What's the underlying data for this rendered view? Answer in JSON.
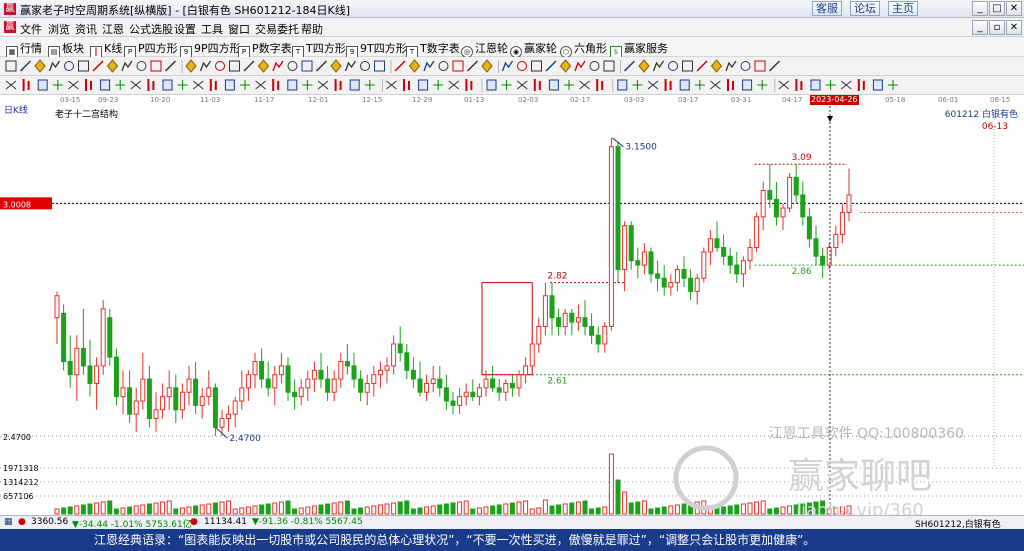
{
  "window": {
    "title": "赢家老子时空周期系统[纵横版] - [白银有色 SH601212-184日K线]",
    "top_buttons": [
      "客服",
      "论坛",
      "主页"
    ]
  },
  "menu": [
    "文件",
    "浏览",
    "资讯",
    "江恩",
    "公式选股",
    "设置",
    "工具",
    "窗口",
    "交易委托",
    "帮助"
  ],
  "toolbar1": [
    "行情",
    "板块",
    "K线",
    "P四方形",
    "9P四方形",
    "P数字表",
    "T四方形",
    "9T四方形",
    "T数字表",
    "江恩轮",
    "赢家轮",
    "六角形",
    "赢家服务"
  ],
  "dates": [
    "03-15",
    "09-23",
    "10-20",
    "11-03",
    "11-17",
    "12-01",
    "12-15",
    "12-29",
    "01-13",
    "02-03",
    "02-17",
    "03-03",
    "03-17",
    "03-31",
    "04-17",
    "2023-04-26",
    "05-18",
    "06-01",
    "06-15"
  ],
  "chart": {
    "period_label": "日K线",
    "indicator": "老子十二宫结构",
    "stock_code": "601212",
    "stock_name": "白银有色",
    "right_date": "06-13",
    "price_box_value": "3.0008",
    "low_label": "2.4700",
    "axis_low": "2.4700",
    "volume_ticks": [
      "1971318",
      "1314212",
      "657106"
    ],
    "markers": {
      "high": "3.1500",
      "box1_top": "2.82",
      "box1_bottom": "2.61",
      "box2_top": "3.09",
      "box2_bottom": "2.86"
    },
    "watermark_1": "江恩工具软件  QQ:100800360",
    "watermark_2": "赢家聊吧",
    "watermark_3": "jiaoba.vip/360"
  },
  "chart_data": {
    "type": "candlestick",
    "title": "老子十二宫结构",
    "ylabel": "",
    "ylim": [
      2.42,
      3.2
    ],
    "candles": [
      [
        2.74,
        2.8,
        2.68,
        2.79
      ],
      [
        2.75,
        2.77,
        2.62,
        2.64
      ],
      [
        2.64,
        2.7,
        2.58,
        2.61
      ],
      [
        2.61,
        2.7,
        2.55,
        2.67
      ],
      [
        2.67,
        2.76,
        2.61,
        2.63
      ],
      [
        2.63,
        2.69,
        2.56,
        2.59
      ],
      [
        2.59,
        2.65,
        2.53,
        2.63
      ],
      [
        2.63,
        2.78,
        2.61,
        2.76
      ],
      [
        2.74,
        2.76,
        2.63,
        2.65
      ],
      [
        2.65,
        2.67,
        2.54,
        2.56
      ],
      [
        2.56,
        2.62,
        2.52,
        2.58
      ],
      [
        2.58,
        2.62,
        2.5,
        2.52
      ],
      [
        2.52,
        2.58,
        2.48,
        2.55
      ],
      [
        2.55,
        2.66,
        2.53,
        2.6
      ],
      [
        2.6,
        2.63,
        2.49,
        2.51
      ],
      [
        2.51,
        2.57,
        2.48,
        2.53
      ],
      [
        2.53,
        2.59,
        2.51,
        2.56
      ],
      [
        2.56,
        2.62,
        2.53,
        2.58
      ],
      [
        2.58,
        2.61,
        2.5,
        2.53
      ],
      [
        2.53,
        2.59,
        2.51,
        2.57
      ],
      [
        2.57,
        2.63,
        2.54,
        2.6
      ],
      [
        2.6,
        2.64,
        2.52,
        2.54
      ],
      [
        2.54,
        2.58,
        2.51,
        2.56
      ],
      [
        2.56,
        2.62,
        2.54,
        2.58
      ],
      [
        2.58,
        2.59,
        2.47,
        2.49
      ],
      [
        2.49,
        2.53,
        2.47,
        2.51
      ],
      [
        2.51,
        2.54,
        2.48,
        2.52
      ],
      [
        2.52,
        2.56,
        2.49,
        2.55
      ],
      [
        2.55,
        2.62,
        2.53,
        2.58
      ],
      [
        2.58,
        2.62,
        2.55,
        2.61
      ],
      [
        2.61,
        2.66,
        2.58,
        2.64
      ],
      [
        2.64,
        2.67,
        2.58,
        2.6
      ],
      [
        2.6,
        2.64,
        2.56,
        2.58
      ],
      [
        2.58,
        2.63,
        2.54,
        2.61
      ],
      [
        2.61,
        2.66,
        2.59,
        2.63
      ],
      [
        2.63,
        2.65,
        2.55,
        2.57
      ],
      [
        2.57,
        2.6,
        2.53,
        2.56
      ],
      [
        2.56,
        2.6,
        2.54,
        2.58
      ],
      [
        2.58,
        2.62,
        2.55,
        2.6
      ],
      [
        2.6,
        2.64,
        2.57,
        2.62
      ],
      [
        2.62,
        2.66,
        2.58,
        2.6
      ],
      [
        2.6,
        2.63,
        2.55,
        2.57
      ],
      [
        2.57,
        2.62,
        2.55,
        2.6
      ],
      [
        2.6,
        2.66,
        2.58,
        2.64
      ],
      [
        2.64,
        2.68,
        2.61,
        2.63
      ],
      [
        2.63,
        2.66,
        2.58,
        2.6
      ],
      [
        2.6,
        2.62,
        2.55,
        2.57
      ],
      [
        2.57,
        2.61,
        2.54,
        2.59
      ],
      [
        2.59,
        2.63,
        2.56,
        2.61
      ],
      [
        2.61,
        2.64,
        2.58,
        2.62
      ],
      [
        2.62,
        2.65,
        2.59,
        2.63
      ],
      [
        2.63,
        2.7,
        2.61,
        2.68
      ],
      [
        2.68,
        2.72,
        2.64,
        2.66
      ],
      [
        2.66,
        2.68,
        2.6,
        2.62
      ],
      [
        2.62,
        2.65,
        2.58,
        2.6
      ],
      [
        2.6,
        2.64,
        2.56,
        2.57
      ],
      [
        2.57,
        2.61,
        2.55,
        2.59
      ],
      [
        2.59,
        2.63,
        2.57,
        2.6
      ],
      [
        2.6,
        2.63,
        2.56,
        2.58
      ],
      [
        2.58,
        2.61,
        2.53,
        2.55
      ],
      [
        2.55,
        2.57,
        2.52,
        2.54
      ],
      [
        2.54,
        2.58,
        2.52,
        2.56
      ],
      [
        2.56,
        2.59,
        2.54,
        2.57
      ],
      [
        2.57,
        2.6,
        2.55,
        2.56
      ],
      [
        2.56,
        2.59,
        2.54,
        2.58
      ],
      [
        2.58,
        2.62,
        2.56,
        2.6
      ],
      [
        2.6,
        2.63,
        2.57,
        2.58
      ],
      [
        2.58,
        2.6,
        2.55,
        2.57
      ],
      [
        2.57,
        2.6,
        2.55,
        2.59
      ],
      [
        2.59,
        2.61,
        2.56,
        2.58
      ],
      [
        2.58,
        2.62,
        2.56,
        2.61
      ],
      [
        2.61,
        2.65,
        2.59,
        2.63
      ],
      [
        2.63,
        2.7,
        2.62,
        2.68
      ],
      [
        2.68,
        2.74,
        2.66,
        2.72
      ],
      [
        2.72,
        2.82,
        2.7,
        2.79
      ],
      [
        2.79,
        2.82,
        2.7,
        2.74
      ],
      [
        2.74,
        2.76,
        2.7,
        2.72
      ],
      [
        2.72,
        2.76,
        2.7,
        2.75
      ],
      [
        2.75,
        2.76,
        2.7,
        2.73
      ],
      [
        2.73,
        2.77,
        2.71,
        2.74
      ],
      [
        2.74,
        2.78,
        2.7,
        2.72
      ],
      [
        2.72,
        2.75,
        2.68,
        2.7
      ],
      [
        2.7,
        2.72,
        2.66,
        2.68
      ],
      [
        2.68,
        2.73,
        2.66,
        2.72
      ],
      [
        2.72,
        3.15,
        2.71,
        3.13
      ],
      [
        3.13,
        3.14,
        2.82,
        2.85
      ],
      [
        2.85,
        2.96,
        2.8,
        2.95
      ],
      [
        2.95,
        2.96,
        2.85,
        2.87
      ],
      [
        2.87,
        2.9,
        2.83,
        2.86
      ],
      [
        2.86,
        2.91,
        2.84,
        2.89
      ],
      [
        2.89,
        2.9,
        2.82,
        2.84
      ],
      [
        2.84,
        2.87,
        2.8,
        2.83
      ],
      [
        2.83,
        2.86,
        2.79,
        2.81
      ],
      [
        2.81,
        2.84,
        2.79,
        2.82
      ],
      [
        2.82,
        2.86,
        2.8,
        2.85
      ],
      [
        2.85,
        2.88,
        2.81,
        2.83
      ],
      [
        2.83,
        2.85,
        2.78,
        2.8
      ],
      [
        2.8,
        2.84,
        2.77,
        2.83
      ],
      [
        2.83,
        2.9,
        2.82,
        2.89
      ],
      [
        2.89,
        2.94,
        2.86,
        2.92
      ],
      [
        2.92,
        2.96,
        2.89,
        2.9
      ],
      [
        2.9,
        2.93,
        2.86,
        2.88
      ],
      [
        2.88,
        2.9,
        2.84,
        2.86
      ],
      [
        2.86,
        2.89,
        2.82,
        2.84
      ],
      [
        2.84,
        2.88,
        2.81,
        2.87
      ],
      [
        2.87,
        2.92,
        2.85,
        2.9
      ],
      [
        2.9,
        2.98,
        2.89,
        2.97
      ],
      [
        2.97,
        3.05,
        2.94,
        3.03
      ],
      [
        3.03,
        3.09,
        2.99,
        3.01
      ],
      [
        3.01,
        3.05,
        2.95,
        2.97
      ],
      [
        2.97,
        3.0,
        2.94,
        2.99
      ],
      [
        2.99,
        3.07,
        2.98,
        3.06
      ],
      [
        3.06,
        3.09,
        3.0,
        3.02
      ],
      [
        3.02,
        3.05,
        2.95,
        2.97
      ],
      [
        2.97,
        2.99,
        2.9,
        2.92
      ],
      [
        2.92,
        2.95,
        2.86,
        2.88
      ],
      [
        2.88,
        2.9,
        2.83,
        2.86
      ],
      [
        2.86,
        2.91,
        2.85,
        2.9
      ],
      [
        2.9,
        2.95,
        2.88,
        2.93
      ],
      [
        2.93,
        3.0,
        2.91,
        2.98
      ],
      [
        2.98,
        3.08,
        2.96,
        3.02
      ]
    ]
  },
  "status": {
    "sh_index": "3360.56",
    "sh_change": "▼-34.44 -1.01% 5753.61亿",
    "sz_index": "11134.41",
    "sz_change": "▼-91.36 -0.81% 5567.45",
    "current": "SH601212,白银有色"
  },
  "quote": "江恩经典语录：“图表能反映出一切股市或公司股民的总体心理状况”，“不要一次性买进，傲慢就是罪过”，“调整只会让股市更加健康”。"
}
